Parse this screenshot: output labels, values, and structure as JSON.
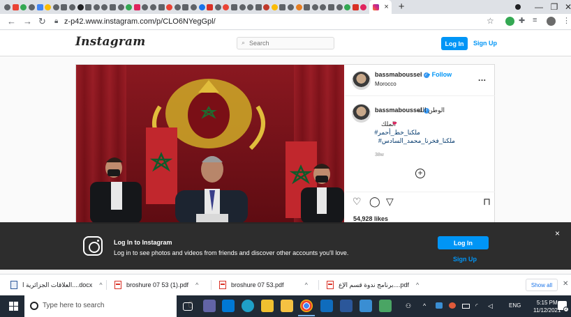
{
  "browser": {
    "active_tab_close": "×",
    "new_tab": "+",
    "window_controls": [
      "—",
      "❐",
      "✕"
    ],
    "nav": {
      "back": "←",
      "forward": "→",
      "reload": "↻"
    },
    "url": "z-p42.www.instagram.com/p/CLO6NYegGpl/"
  },
  "instagram": {
    "logo": "Instagram",
    "search_placeholder": "Search",
    "login_label": "Log In",
    "signup_label": "Sign Up",
    "post": {
      "username": "bassmaboussel",
      "follow_label": "• Follow",
      "location": "Morocco",
      "more": "...",
      "caption_lines": [
        "الوطن  الله",
        "الملك",
        "ملكنا_خط_أحمر#",
        "ملكنا_فخرنا_محمد_السادس#"
      ],
      "caption_hashtag_color": "#00376b",
      "age": "38w",
      "likes": "54,928 likes"
    },
    "banner": {
      "title": "Log In to Instagram",
      "subtitle": "Log in to see photos and videos from friends and discover other accounts you'll love.",
      "login_label": "Log In",
      "signup_label": "Sign Up",
      "close": "×"
    }
  },
  "downloads": {
    "items": [
      {
        "name": "العلاقات الجزائرية ا....docx",
        "type": "doc"
      },
      {
        "name": "broshure 07 53 (1).pdf",
        "type": "pdf"
      },
      {
        "name": "broshure 07 53.pdf",
        "type": "pdf"
      },
      {
        "name": "برنامج ندوة قسم الإع....pdf",
        "type": "pdf"
      }
    ],
    "chevron": "^",
    "show_all": "Show all",
    "close": "✕"
  },
  "taskbar": {
    "search_placeholder": "Type here to search",
    "language": "ENG",
    "time": "5:15 PM",
    "date": "11/12/2021",
    "notification_count": "2"
  },
  "colors": {
    "ig_blue": "#0095f6",
    "banner_bg": "#262626",
    "taskbar_bg": "#202a36",
    "tab_strip_bg": "#dee1e6"
  }
}
